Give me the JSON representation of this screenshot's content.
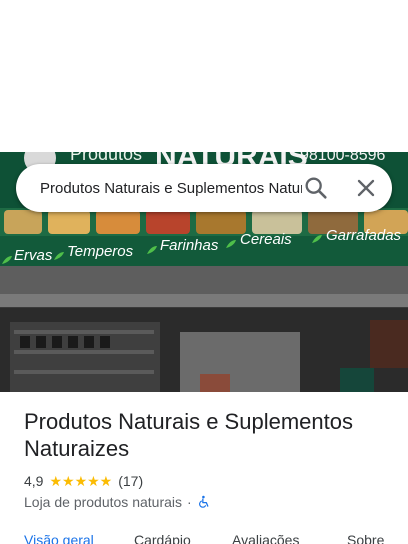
{
  "search": {
    "query": "Produtos Naturais e Suplementos Naturaizes"
  },
  "photo": {
    "sign_phone": "98100-8596",
    "sign_brand": "NATURAIS",
    "sign_brand_prefix": "Produtos",
    "sign_products": [
      "Ervas",
      "Temperos",
      "Farinhas",
      "Cereais",
      "Garrafadas"
    ]
  },
  "place": {
    "name": "Produtos Naturais e Suplementos Naturaizes",
    "rating": "4,9",
    "stars": "★★★★★",
    "reviews": "(17)",
    "category": "Loja de produtos naturais",
    "separator": "·"
  },
  "tabs": [
    {
      "label": "Visão geral",
      "active": true
    },
    {
      "label": "Cardápio",
      "active": false
    },
    {
      "label": "Avaliações",
      "active": false
    },
    {
      "label": "Sobre",
      "active": false
    }
  ],
  "colors": {
    "accent": "#1a73e8",
    "star": "#fbbc04",
    "sign_green": "#0f5a3a",
    "sign_leaf": "#4fbf4a"
  }
}
